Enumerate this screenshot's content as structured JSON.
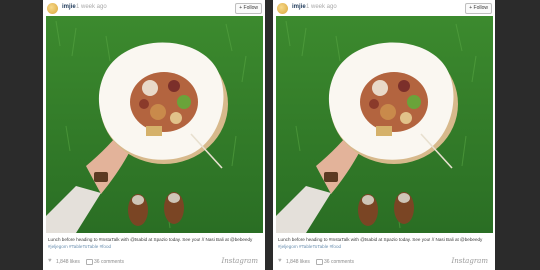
{
  "post": {
    "username": "imjie",
    "time": "1 week ago",
    "follow_label": "+ Follow",
    "caption": "Lunch before heading to #InstaTalk with @tsabid at Spazio today. See you! // Nasi Bali at @bebeedy",
    "tags": "#jeljegom #TableToTable #food",
    "likes": "1,848 likes",
    "comments": "36 comments",
    "brand": "Instagram"
  },
  "colors": {
    "username": "#1f3a5a",
    "grass": "#2f7a2a",
    "hashtag": "#6a8fb0"
  },
  "icons": [
    "avatar",
    "heart-icon",
    "comment-icon"
  ]
}
